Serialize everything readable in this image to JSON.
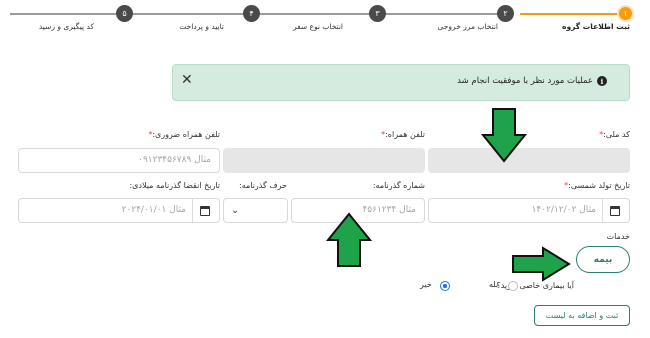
{
  "stepper": {
    "steps": [
      {
        "number": "۱",
        "label": "ثبت اطلاعات گروه",
        "active": true
      },
      {
        "number": "۲",
        "label": "انتخاب مرز خروجی",
        "active": false
      },
      {
        "number": "۳",
        "label": "انتخاب نوع سفر",
        "active": false
      },
      {
        "number": "۴",
        "label": "تایید و پرداخت",
        "active": false
      },
      {
        "number": "۵",
        "label": "کد پیگیری و رسید",
        "active": false
      }
    ],
    "accent_color": "#f39c12"
  },
  "alert": {
    "message": "عملیات مورد نظر با موفقیت انجام شد",
    "close_symbol": "✕",
    "info_symbol": "i",
    "background": "#d6ebe0"
  },
  "form": {
    "national_code": {
      "label": "کد ملی:",
      "required_mark": "*"
    },
    "companion_phone": {
      "label": "تلفن همراه:",
      "required_mark": "*"
    },
    "emergency_phone": {
      "label": "تلفن همراه ضروری:",
      "required_mark": "*",
      "placeholder": "مثال ۰۹۱۲۳۴۵۶۷۸۹"
    },
    "birth_date": {
      "label": "تاریخ تولد شمسی:",
      "required_mark": "*",
      "placeholder": "مثال ۱۴۰۲/۱۲/۰۲"
    },
    "passport_number": {
      "label": "شماره گذرنامه:",
      "placeholder": "مثال ۴۵۶۱۲۳۴"
    },
    "passport_letter": {
      "label": "حرف گذرنامه:",
      "value": ""
    },
    "passport_expiry": {
      "label": "تاریخ انقضا گذرنامه میلادی:",
      "placeholder": "مثال ۲۰۲۴/۰۱/۰۱"
    }
  },
  "services": {
    "label": "خدمات",
    "insurance_button": "بیمه"
  },
  "disease_question": {
    "label": "آیا بیماری خاصی دارید؟",
    "options": [
      {
        "label": "بله",
        "checked": false
      },
      {
        "label": "خیر",
        "checked": true
      }
    ]
  },
  "submit_button": "ثبت و اضافه به لیست",
  "annotation_color": "#1fa34a"
}
